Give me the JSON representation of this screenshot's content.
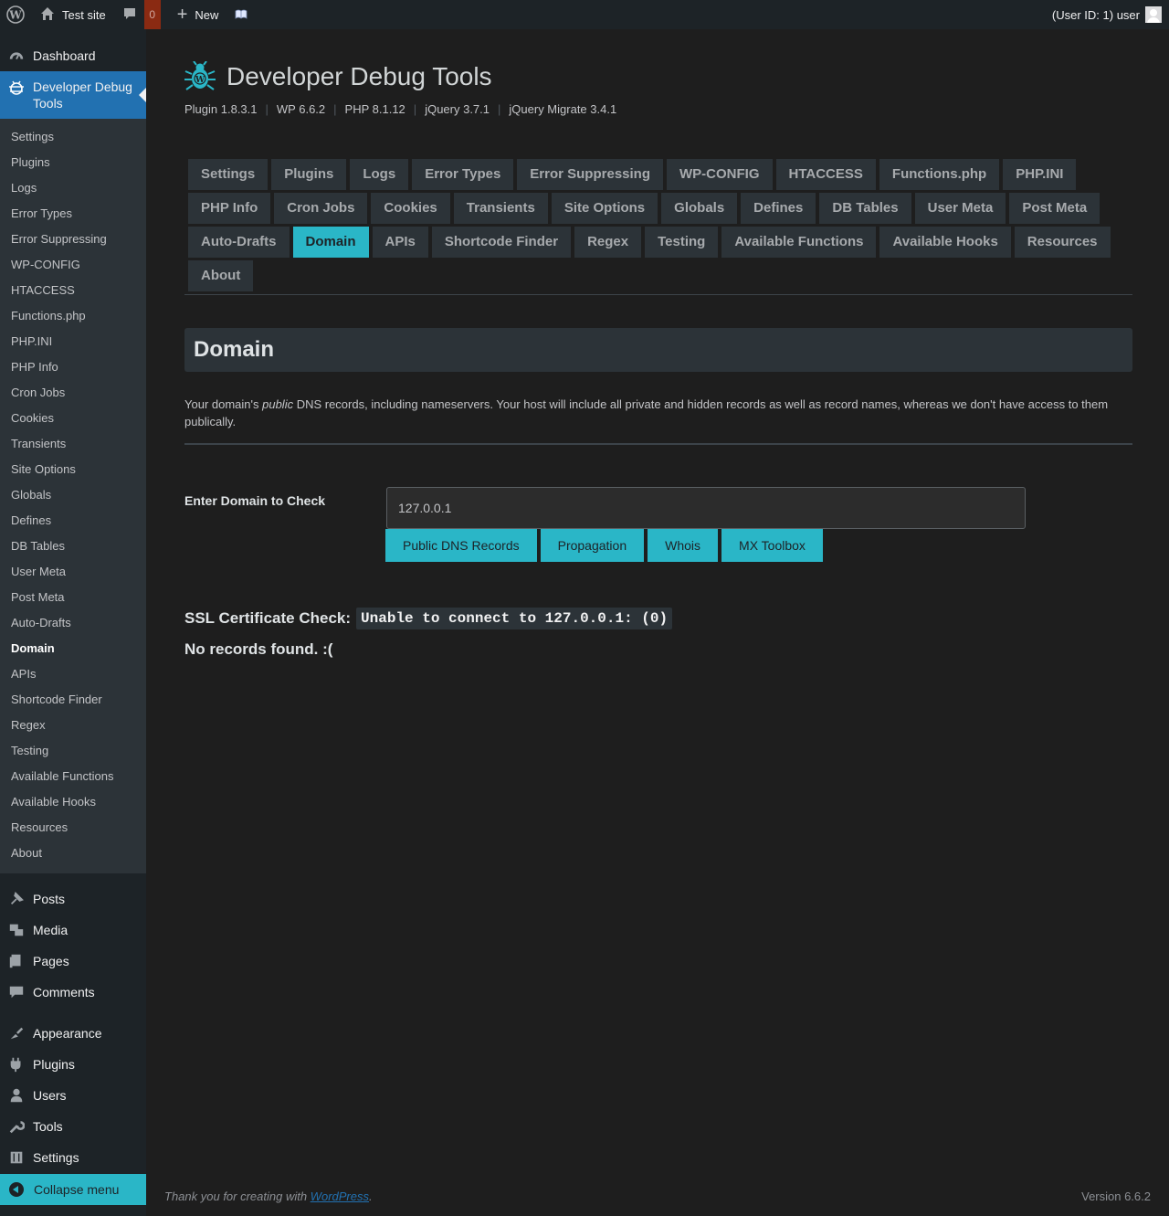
{
  "admin_bar": {
    "site_name": "Test site",
    "comment_count": "0",
    "new_label": "New",
    "user_label": "(User ID: 1) user"
  },
  "sidebar": {
    "dashboard": "Dashboard",
    "current_plugin": "Developer Debug Tools",
    "submenu": [
      "Settings",
      "Plugins",
      "Logs",
      "Error Types",
      "Error Suppressing",
      "WP-CONFIG",
      "HTACCESS",
      "Functions.php",
      "PHP.INI",
      "PHP Info",
      "Cron Jobs",
      "Cookies",
      "Transients",
      "Site Options",
      "Globals",
      "Defines",
      "DB Tables",
      "User Meta",
      "Post Meta",
      "Auto-Drafts",
      "Domain",
      "APIs",
      "Shortcode Finder",
      "Regex",
      "Testing",
      "Available Functions",
      "Available Hooks",
      "Resources",
      "About"
    ],
    "current_submenu": "Domain",
    "group1": [
      "Posts",
      "Media",
      "Pages",
      "Comments"
    ],
    "group2": [
      "Appearance",
      "Plugins",
      "Users",
      "Tools",
      "Settings"
    ],
    "collapse": "Collapse menu"
  },
  "header": {
    "title": "Developer Debug Tools",
    "versions": [
      "Plugin 1.8.3.1",
      "WP 6.6.2",
      "PHP 8.1.12",
      "jQuery 3.7.1",
      "jQuery Migrate 3.4.1"
    ]
  },
  "tabs": {
    "rows": [
      [
        "Settings",
        "Plugins",
        "Logs",
        "Error Types",
        "Error Suppressing",
        "WP-CONFIG",
        "HTACCESS",
        "Functions.php",
        "PHP.INI"
      ],
      [
        "PHP Info",
        "Cron Jobs",
        "Cookies",
        "Transients",
        "Site Options",
        "Globals",
        "Defines",
        "DB Tables",
        "User Meta",
        "Post Meta"
      ],
      [
        "Auto-Drafts",
        "Domain",
        "APIs",
        "Shortcode Finder",
        "Regex",
        "Testing",
        "Available Functions",
        "Available Hooks",
        "Resources"
      ],
      [
        "About"
      ]
    ],
    "active": "Domain"
  },
  "section": {
    "title": "Domain",
    "desc_before": "Your domain's ",
    "desc_em": "public",
    "desc_after": " DNS records, including nameservers. Your host will include all private and hidden records as well as record names, whereas we don't have access to them publically."
  },
  "form": {
    "label": "Enter Domain to Check",
    "value": "127.0.0.1",
    "buttons": [
      "Public DNS Records",
      "Propagation",
      "Whois",
      "MX Toolbox"
    ]
  },
  "results": {
    "ssl_label": "SSL Certificate Check:",
    "ssl_value": "Unable to connect to 127.0.0.1: (0)",
    "no_records": "No records found. :("
  },
  "footer": {
    "thanks_before": "Thank you for creating with ",
    "thanks_link": "WordPress",
    "thanks_after": ".",
    "version": "Version 6.6.2"
  },
  "colors": {
    "accent": "#2ab6c7",
    "wp_blue": "#2271b1",
    "admin_bar": "#1d2327",
    "background": "#1e1e1e"
  }
}
